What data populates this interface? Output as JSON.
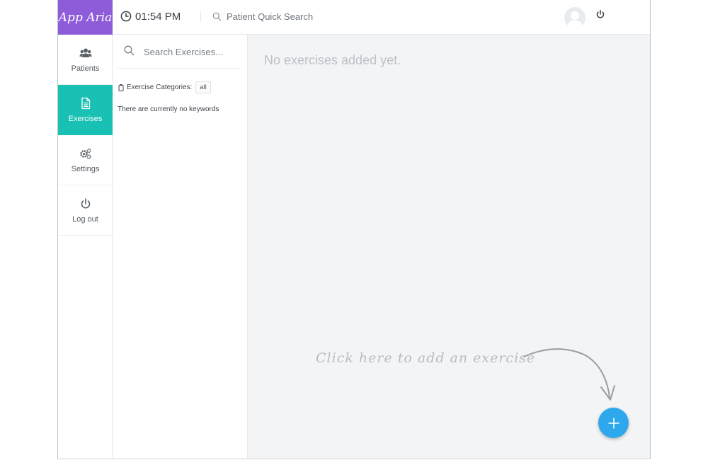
{
  "app": {
    "logo_text": "App Aria",
    "brand_color": "#8e5cd9",
    "accent_color": "#18c1b3",
    "fab_color": "#2ea8ec"
  },
  "header": {
    "clock_icon": "clock-icon",
    "time": "01:54 PM",
    "quick_search_placeholder": "Patient Quick Search",
    "avatar_icon": "user-avatar",
    "power_icon": "power-icon"
  },
  "sidebar": {
    "items": [
      {
        "label": "Patients",
        "icon": "users-icon",
        "active": false
      },
      {
        "label": "Exercises",
        "icon": "document-icon",
        "active": true
      },
      {
        "label": "Settings",
        "icon": "gears-icon",
        "active": false
      },
      {
        "label": "Log out",
        "icon": "power-icon",
        "active": false
      }
    ]
  },
  "exercise_panel": {
    "search_placeholder": "Search Exercises...",
    "categories_label": "Exercise Categories:",
    "categories_value": "all",
    "no_keywords_text": "There are currently no keywords"
  },
  "main": {
    "empty_message": "No exercises added yet.",
    "hint_text": "Click here to add an exercise",
    "add_button_icon": "plus-icon"
  }
}
